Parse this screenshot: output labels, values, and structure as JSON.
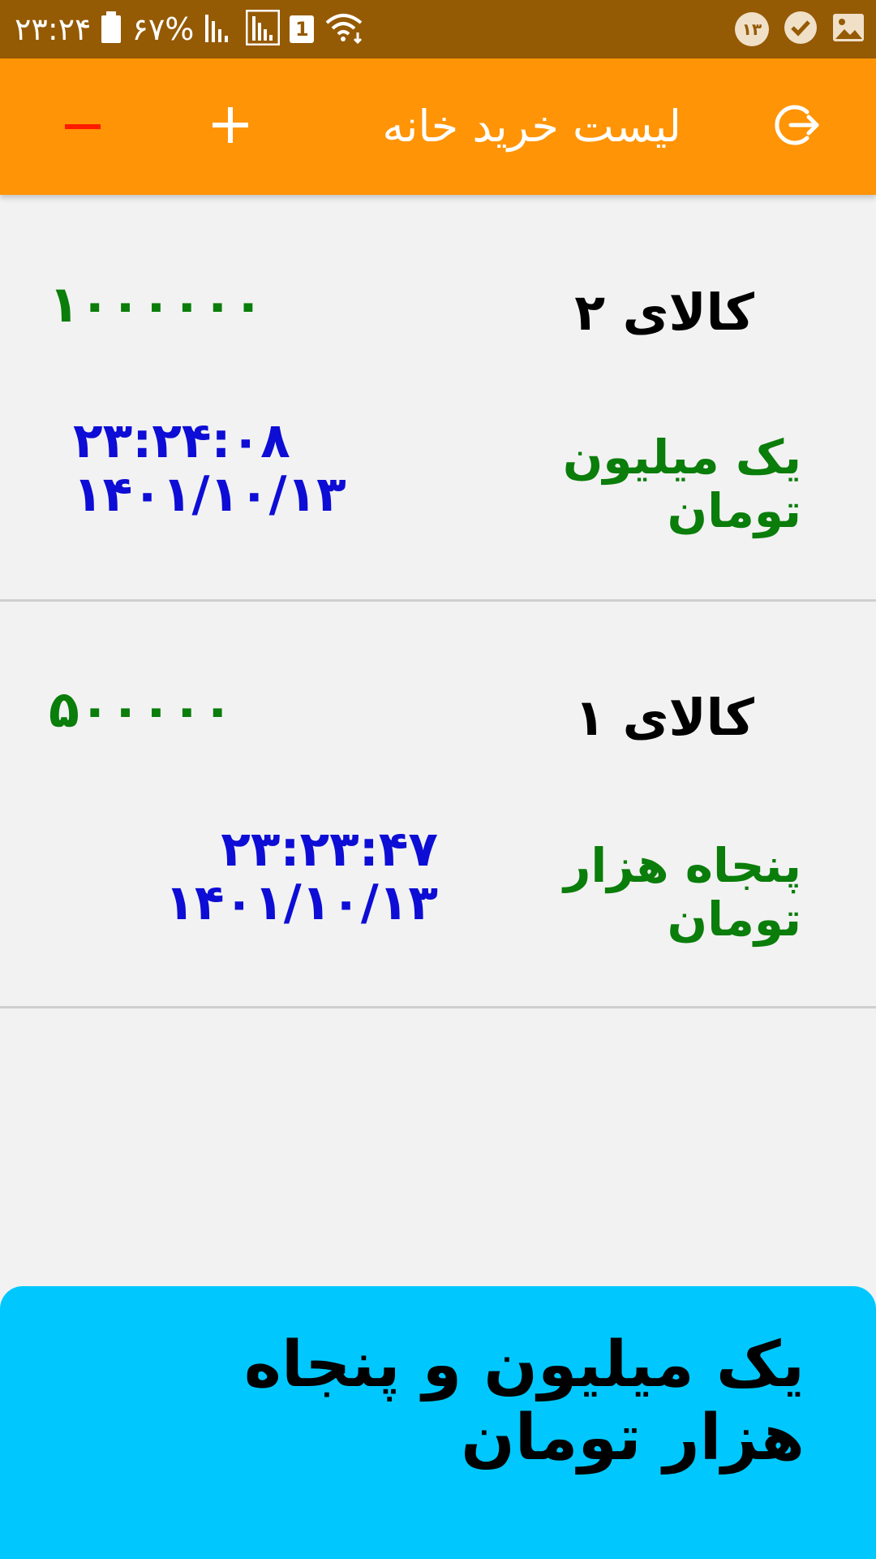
{
  "status_bar": {
    "time": "۲۳:۲۴",
    "battery": "۶۷%",
    "sim_slot": "1",
    "notification_count": "۱۳"
  },
  "toolbar": {
    "title": "لیست  خرید خانه",
    "colors": {
      "background": "#ff9406",
      "minus": "#ff1a00",
      "plus": "#ffffff"
    }
  },
  "items": [
    {
      "name": "کالای ۲",
      "price": "۱۰۰۰۰۰۰",
      "price_words": "یک  میلیون  تومان",
      "time": "۲۳:۲۴:۰۸",
      "date": "۱۴۰۱/۱۰/۱۳"
    },
    {
      "name": "کالای ۱",
      "price": "۵۰۰۰۰۰",
      "price_words": "پنجاه  هزار  تومان",
      "time": "۲۳:۲۳:۴۷",
      "date": "۱۴۰۱/۱۰/۱۳"
    }
  ],
  "total": {
    "text": "یک  میلیون  و  پنجاه  هزار  تومان",
    "color": "#00c8ff"
  }
}
